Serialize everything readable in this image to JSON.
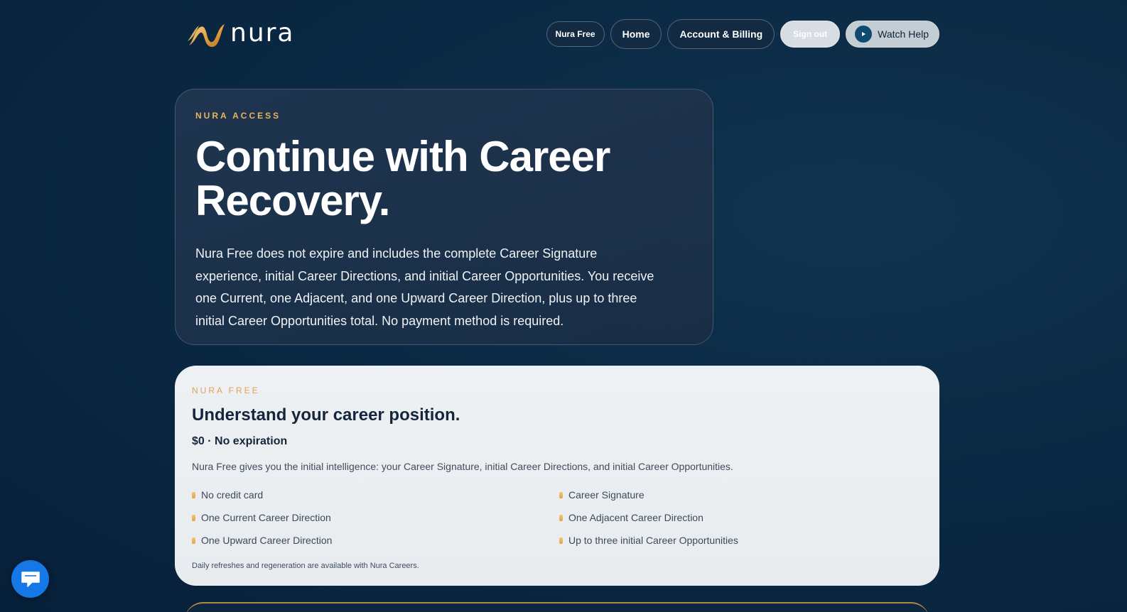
{
  "brand": {
    "name": "nura",
    "colors": {
      "gold": "#e8b35a",
      "navy": "#07203a",
      "chat_blue": "#1677e6"
    }
  },
  "nav": {
    "plan_badge": "Nura Free",
    "home": "Home",
    "account_billing": "Account & Billing",
    "sign_out": "Sign out",
    "watch_help": "Watch Help"
  },
  "hero": {
    "eyebrow": "NURA ACCESS",
    "title_line1": "Continue with Career",
    "title_line2": "Recovery.",
    "body": "Nura Free does not expire and includes the complete Career Signature experience, initial Career Directions, and initial Career Opportunities. You receive one Current, one Adjacent, and one Upward Career Direction, plus up to three initial Career Opportunities total. No payment method is required."
  },
  "plan": {
    "eyebrow": "NURA FREE",
    "title": "Understand your career position.",
    "price": "$0 · No expiration",
    "description": "Nura Free gives you the initial intelligence: your Career Signature, initial Career Directions, and initial Career Opportunities.",
    "features": [
      "No credit card",
      "Career Signature",
      "One Current Career Direction",
      "One Adjacent Career Direction",
      "One Upward Career Direction",
      "Up to three initial Career Opportunities"
    ],
    "note": "Daily refreshes and regeneration are available with Nura Careers."
  },
  "icons": {
    "logo": "nura-logo-mark",
    "help": "play-icon",
    "chat": "chat-icon",
    "bullet": "bullet-icon"
  }
}
